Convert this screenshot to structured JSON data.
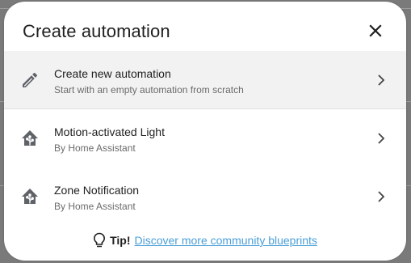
{
  "dialog": {
    "title": "Create automation",
    "close_icon": "close-icon"
  },
  "items": [
    {
      "title": "Create new automation",
      "subtitle": "Start with an empty automation from scratch",
      "icon": "pencil-icon",
      "selected": true
    },
    {
      "title": "Motion-activated Light",
      "subtitle": "By Home Assistant",
      "icon": "home-assistant-icon",
      "selected": false
    },
    {
      "title": "Zone Notification",
      "subtitle": "By Home Assistant",
      "icon": "home-assistant-icon",
      "selected": false
    }
  ],
  "tip": {
    "label": "Tip!",
    "link_text": "Discover more community blueprints",
    "icon": "lightbulb-icon"
  },
  "colors": {
    "link": "#4a9fd8",
    "selected_bg": "#f2f2f2",
    "icon": "#5f6368"
  }
}
